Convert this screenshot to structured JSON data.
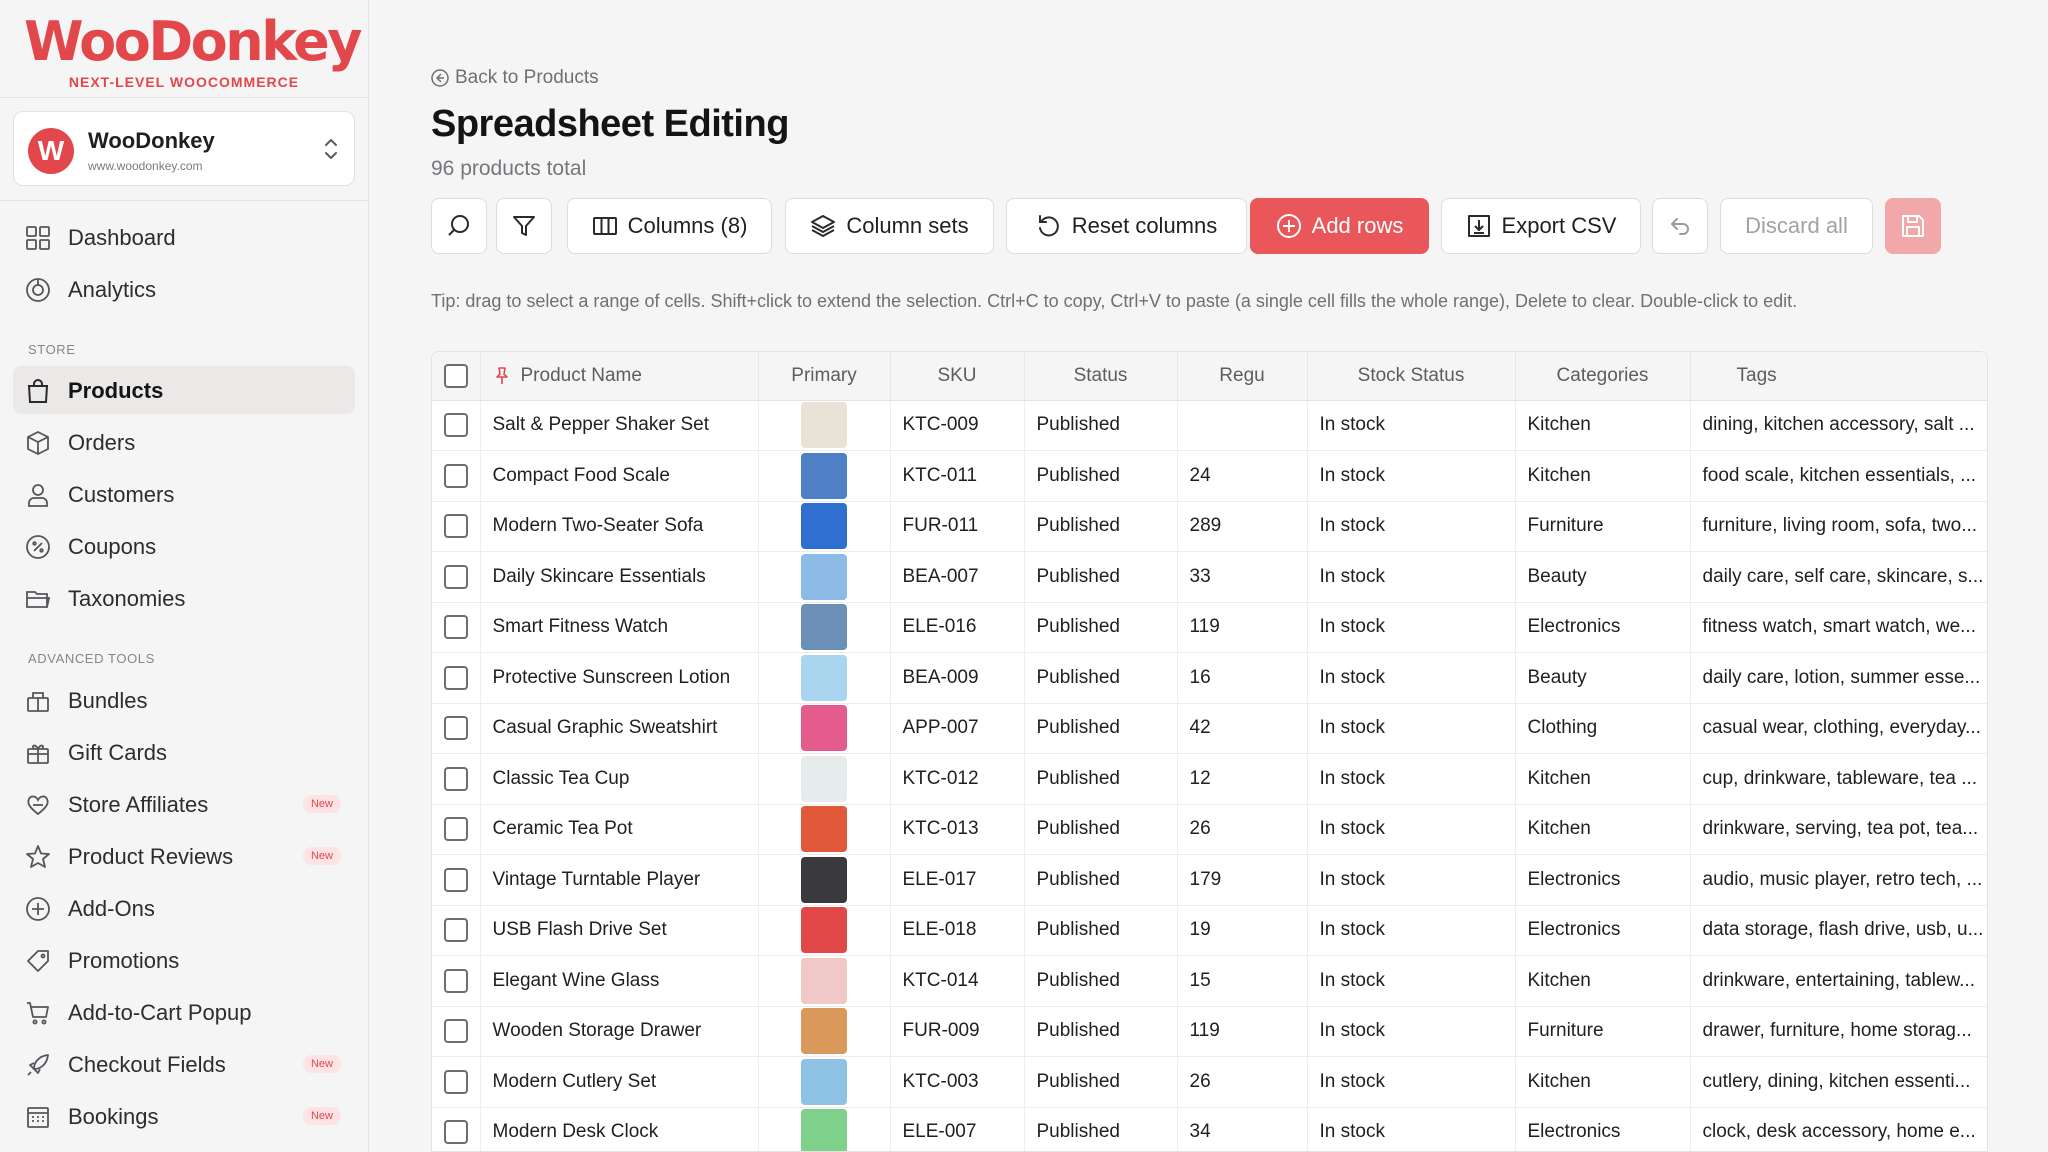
{
  "brand": {
    "name": "WooDonkey",
    "tagline": "NEXT-LEVEL WOOCOMMERCE"
  },
  "store": {
    "initial": "W",
    "name": "WooDonkey",
    "url": "www.woodonkey.com"
  },
  "nav": {
    "top": [
      {
        "label": "Dashboard",
        "icon": "dashboard-grid-icon"
      },
      {
        "label": "Analytics",
        "icon": "analytics-icon"
      }
    ],
    "store_title": "STORE",
    "store_items": [
      {
        "label": "Products",
        "icon": "shopping-bag-icon",
        "active": true
      },
      {
        "label": "Orders",
        "icon": "box-icon"
      },
      {
        "label": "Customers",
        "icon": "user-icon"
      },
      {
        "label": "Coupons",
        "icon": "coupon-icon"
      },
      {
        "label": "Taxonomies",
        "icon": "folder-icon"
      }
    ],
    "tools_title": "ADVANCED TOOLS",
    "tools_items": [
      {
        "label": "Bundles",
        "icon": "bundles-icon"
      },
      {
        "label": "Gift Cards",
        "icon": "gift-icon"
      },
      {
        "label": "Store Affiliates",
        "icon": "affiliates-icon",
        "badge": "New"
      },
      {
        "label": "Product Reviews",
        "icon": "star-icon",
        "badge": "New"
      },
      {
        "label": "Add-Ons",
        "icon": "plus-circle-icon"
      },
      {
        "label": "Promotions",
        "icon": "tag-icon"
      },
      {
        "label": "Add-to-Cart Popup",
        "icon": "cart-icon"
      },
      {
        "label": "Checkout Fields",
        "icon": "rocket-icon",
        "badge": "New"
      },
      {
        "label": "Bookings",
        "icon": "calendar-icon",
        "badge": "New"
      }
    ]
  },
  "page": {
    "back_label": "Back to Products",
    "title": "Spreadsheet Editing",
    "subtitle": "96 products total",
    "tip": "Tip: drag to select a range of cells. Shift+click to extend the selection. Ctrl+C to copy, Ctrl+V to paste (a single cell fills the whole range), Delete to clear. Double-click to edit."
  },
  "toolbar": {
    "columns": "Columns (8)",
    "column_sets": "Column sets",
    "reset_columns": "Reset columns",
    "add_rows": "Add rows",
    "export_csv": "Export CSV",
    "discard_all": "Discard all"
  },
  "colors": {
    "accent": "#e9575a",
    "brand": "#e2474b"
  },
  "table": {
    "headers": [
      "Product Name",
      "Primary",
      "SKU",
      "Status",
      "Regu",
      "Stock Status",
      "Categories",
      "Tags"
    ],
    "rows": [
      {
        "name": "Salt & Pepper Shaker Set",
        "sku": "KTC-009",
        "status": "Published",
        "price": "",
        "stock": "In stock",
        "category": "Kitchen",
        "tags": "dining, kitchen accessory, salt ...",
        "thumb": "#e9e2d6"
      },
      {
        "name": "Compact Food Scale",
        "sku": "KTC-011",
        "status": "Published",
        "price": "24",
        "stock": "In stock",
        "category": "Kitchen",
        "tags": "food scale, kitchen essentials, ...",
        "thumb": "#4f7fc4"
      },
      {
        "name": "Modern Two-Seater Sofa",
        "sku": "FUR-011",
        "status": "Published",
        "price": "289",
        "stock": "In stock",
        "category": "Furniture",
        "tags": "furniture, living room, sofa, two...",
        "thumb": "#2f6fd0"
      },
      {
        "name": "Daily Skincare Essentials",
        "sku": "BEA-007",
        "status": "Published",
        "price": "33",
        "stock": "In stock",
        "category": "Beauty",
        "tags": "daily care, self care, skincare, s...",
        "thumb": "#8cbbe6"
      },
      {
        "name": "Smart Fitness Watch",
        "sku": "ELE-016",
        "status": "Published",
        "price": "119",
        "stock": "In stock",
        "category": "Electronics",
        "tags": "fitness watch, smart watch, we...",
        "thumb": "#6c8fb8"
      },
      {
        "name": "Protective Sunscreen Lotion",
        "sku": "BEA-009",
        "status": "Published",
        "price": "16",
        "stock": "In stock",
        "category": "Beauty",
        "tags": "daily care, lotion, summer esse...",
        "thumb": "#a9d6ee"
      },
      {
        "name": "Casual Graphic Sweatshirt",
        "sku": "APP-007",
        "status": "Published",
        "price": "42",
        "stock": "In stock",
        "category": "Clothing",
        "tags": "casual wear, clothing, everyday...",
        "thumb": "#e55b8b"
      },
      {
        "name": "Classic Tea Cup",
        "sku": "KTC-012",
        "status": "Published",
        "price": "12",
        "stock": "In stock",
        "category": "Kitchen",
        "tags": "cup, drinkware, tableware, tea ...",
        "thumb": "#e6ecec"
      },
      {
        "name": "Ceramic Tea Pot",
        "sku": "KTC-013",
        "status": "Published",
        "price": "26",
        "stock": "In stock",
        "category": "Kitchen",
        "tags": "drinkware, serving, tea pot, tea...",
        "thumb": "#e05a3a"
      },
      {
        "name": "Vintage Turntable Player",
        "sku": "ELE-017",
        "status": "Published",
        "price": "179",
        "stock": "In stock",
        "category": "Electronics",
        "tags": "audio, music player, retro tech, ...",
        "thumb": "#3a3a3e"
      },
      {
        "name": "USB Flash Drive Set",
        "sku": "ELE-018",
        "status": "Published",
        "price": "19",
        "stock": "In stock",
        "category": "Electronics",
        "tags": "data storage, flash drive, usb, u...",
        "thumb": "#e24848"
      },
      {
        "name": "Elegant Wine Glass",
        "sku": "KTC-014",
        "status": "Published",
        "price": "15",
        "stock": "In stock",
        "category": "Kitchen",
        "tags": "drinkware, entertaining, tablew...",
        "thumb": "#f0c8c8"
      },
      {
        "name": "Wooden Storage Drawer",
        "sku": "FUR-009",
        "status": "Published",
        "price": "119",
        "stock": "In stock",
        "category": "Furniture",
        "tags": "drawer, furniture, home storag...",
        "thumb": "#d99a5b"
      },
      {
        "name": "Modern Cutlery Set",
        "sku": "KTC-003",
        "status": "Published",
        "price": "26",
        "stock": "In stock",
        "category": "Kitchen",
        "tags": "cutlery, dining, kitchen essenti...",
        "thumb": "#8ec3e6"
      },
      {
        "name": "Modern Desk Clock",
        "sku": "ELE-007",
        "status": "Published",
        "price": "34",
        "stock": "In stock",
        "category": "Electronics",
        "tags": "clock, desk accessory, home e...",
        "thumb": "#7fd08a"
      }
    ]
  }
}
